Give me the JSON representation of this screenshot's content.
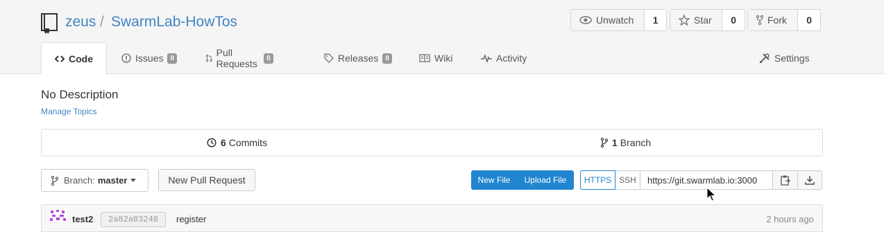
{
  "repo": {
    "owner": "zeus",
    "separator": "/",
    "name": "SwarmLab-HowTos"
  },
  "actions": {
    "watch": {
      "label": "Unwatch",
      "count": "1"
    },
    "star": {
      "label": "Star",
      "count": "0"
    },
    "fork": {
      "label": "Fork",
      "count": "0"
    }
  },
  "tabs": [
    {
      "label": "Code",
      "active": true,
      "icon": "code-icon"
    },
    {
      "label": "Issues",
      "badge": "0",
      "icon": "issue-icon"
    },
    {
      "label": "Pull Requests",
      "badge": "0",
      "icon": "pull-request-icon"
    },
    {
      "label": "Releases",
      "badge": "0",
      "icon": "tag-icon"
    },
    {
      "label": "Wiki",
      "icon": "book-icon"
    },
    {
      "label": "Activity",
      "icon": "pulse-icon"
    }
  ],
  "settings": {
    "label": "Settings",
    "icon": "tools-icon"
  },
  "description": "No Description",
  "manage_topics": "Manage Topics",
  "stats": {
    "commits": {
      "count": "6",
      "label": "Commits"
    },
    "branches": {
      "count": "1",
      "label": "Branch"
    }
  },
  "branch": {
    "prefix": "Branch:",
    "name": "master"
  },
  "new_pull_request": "New Pull Request",
  "file_buttons": {
    "new_file": "New File",
    "upload_file": "Upload File"
  },
  "clone": {
    "https": "HTTPS",
    "ssh": "SSH",
    "url": "https://git.swarmlab.io:3000"
  },
  "latest_commit": {
    "author": "test2",
    "sha": "2a82a83248",
    "message": "register",
    "time": "2 hours ago"
  },
  "colors": {
    "link": "#4183c4",
    "primary": "#2185d0",
    "header_bg": "#f5f5f5"
  }
}
